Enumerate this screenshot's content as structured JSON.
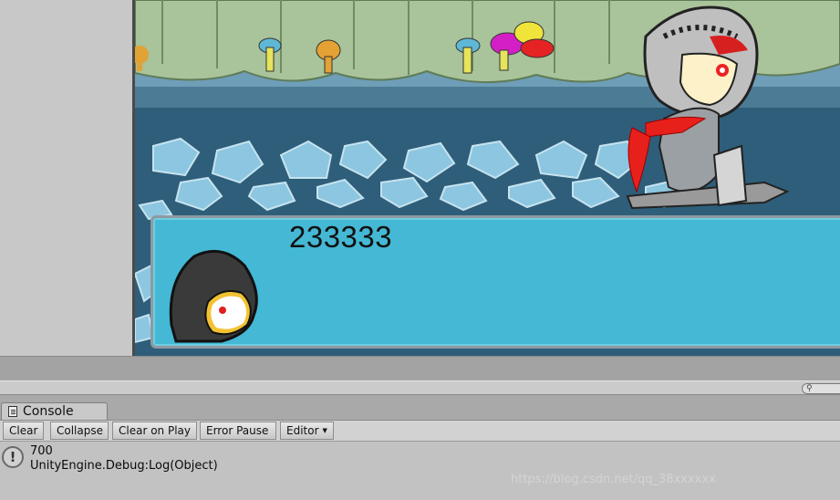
{
  "game": {
    "dialog_text": "233333"
  },
  "console": {
    "tab_label": "Console",
    "toolbar": {
      "clear": "Clear",
      "collapse": "Collapse",
      "clear_on_play": "Clear on Play",
      "error_pause": "Error Pause",
      "editor": "Editor"
    },
    "entries": [
      {
        "icon": "info-icon",
        "line1": "700",
        "line2": "UnityEngine.Debug:Log(Object)"
      }
    ]
  },
  "watermark": "https://blog.csdn.net/qq_38xxxxxx",
  "colors": {
    "dialog_fill": "#44b8d4",
    "wall": "#4d86a6",
    "knight_scarf": "#e8201c"
  }
}
